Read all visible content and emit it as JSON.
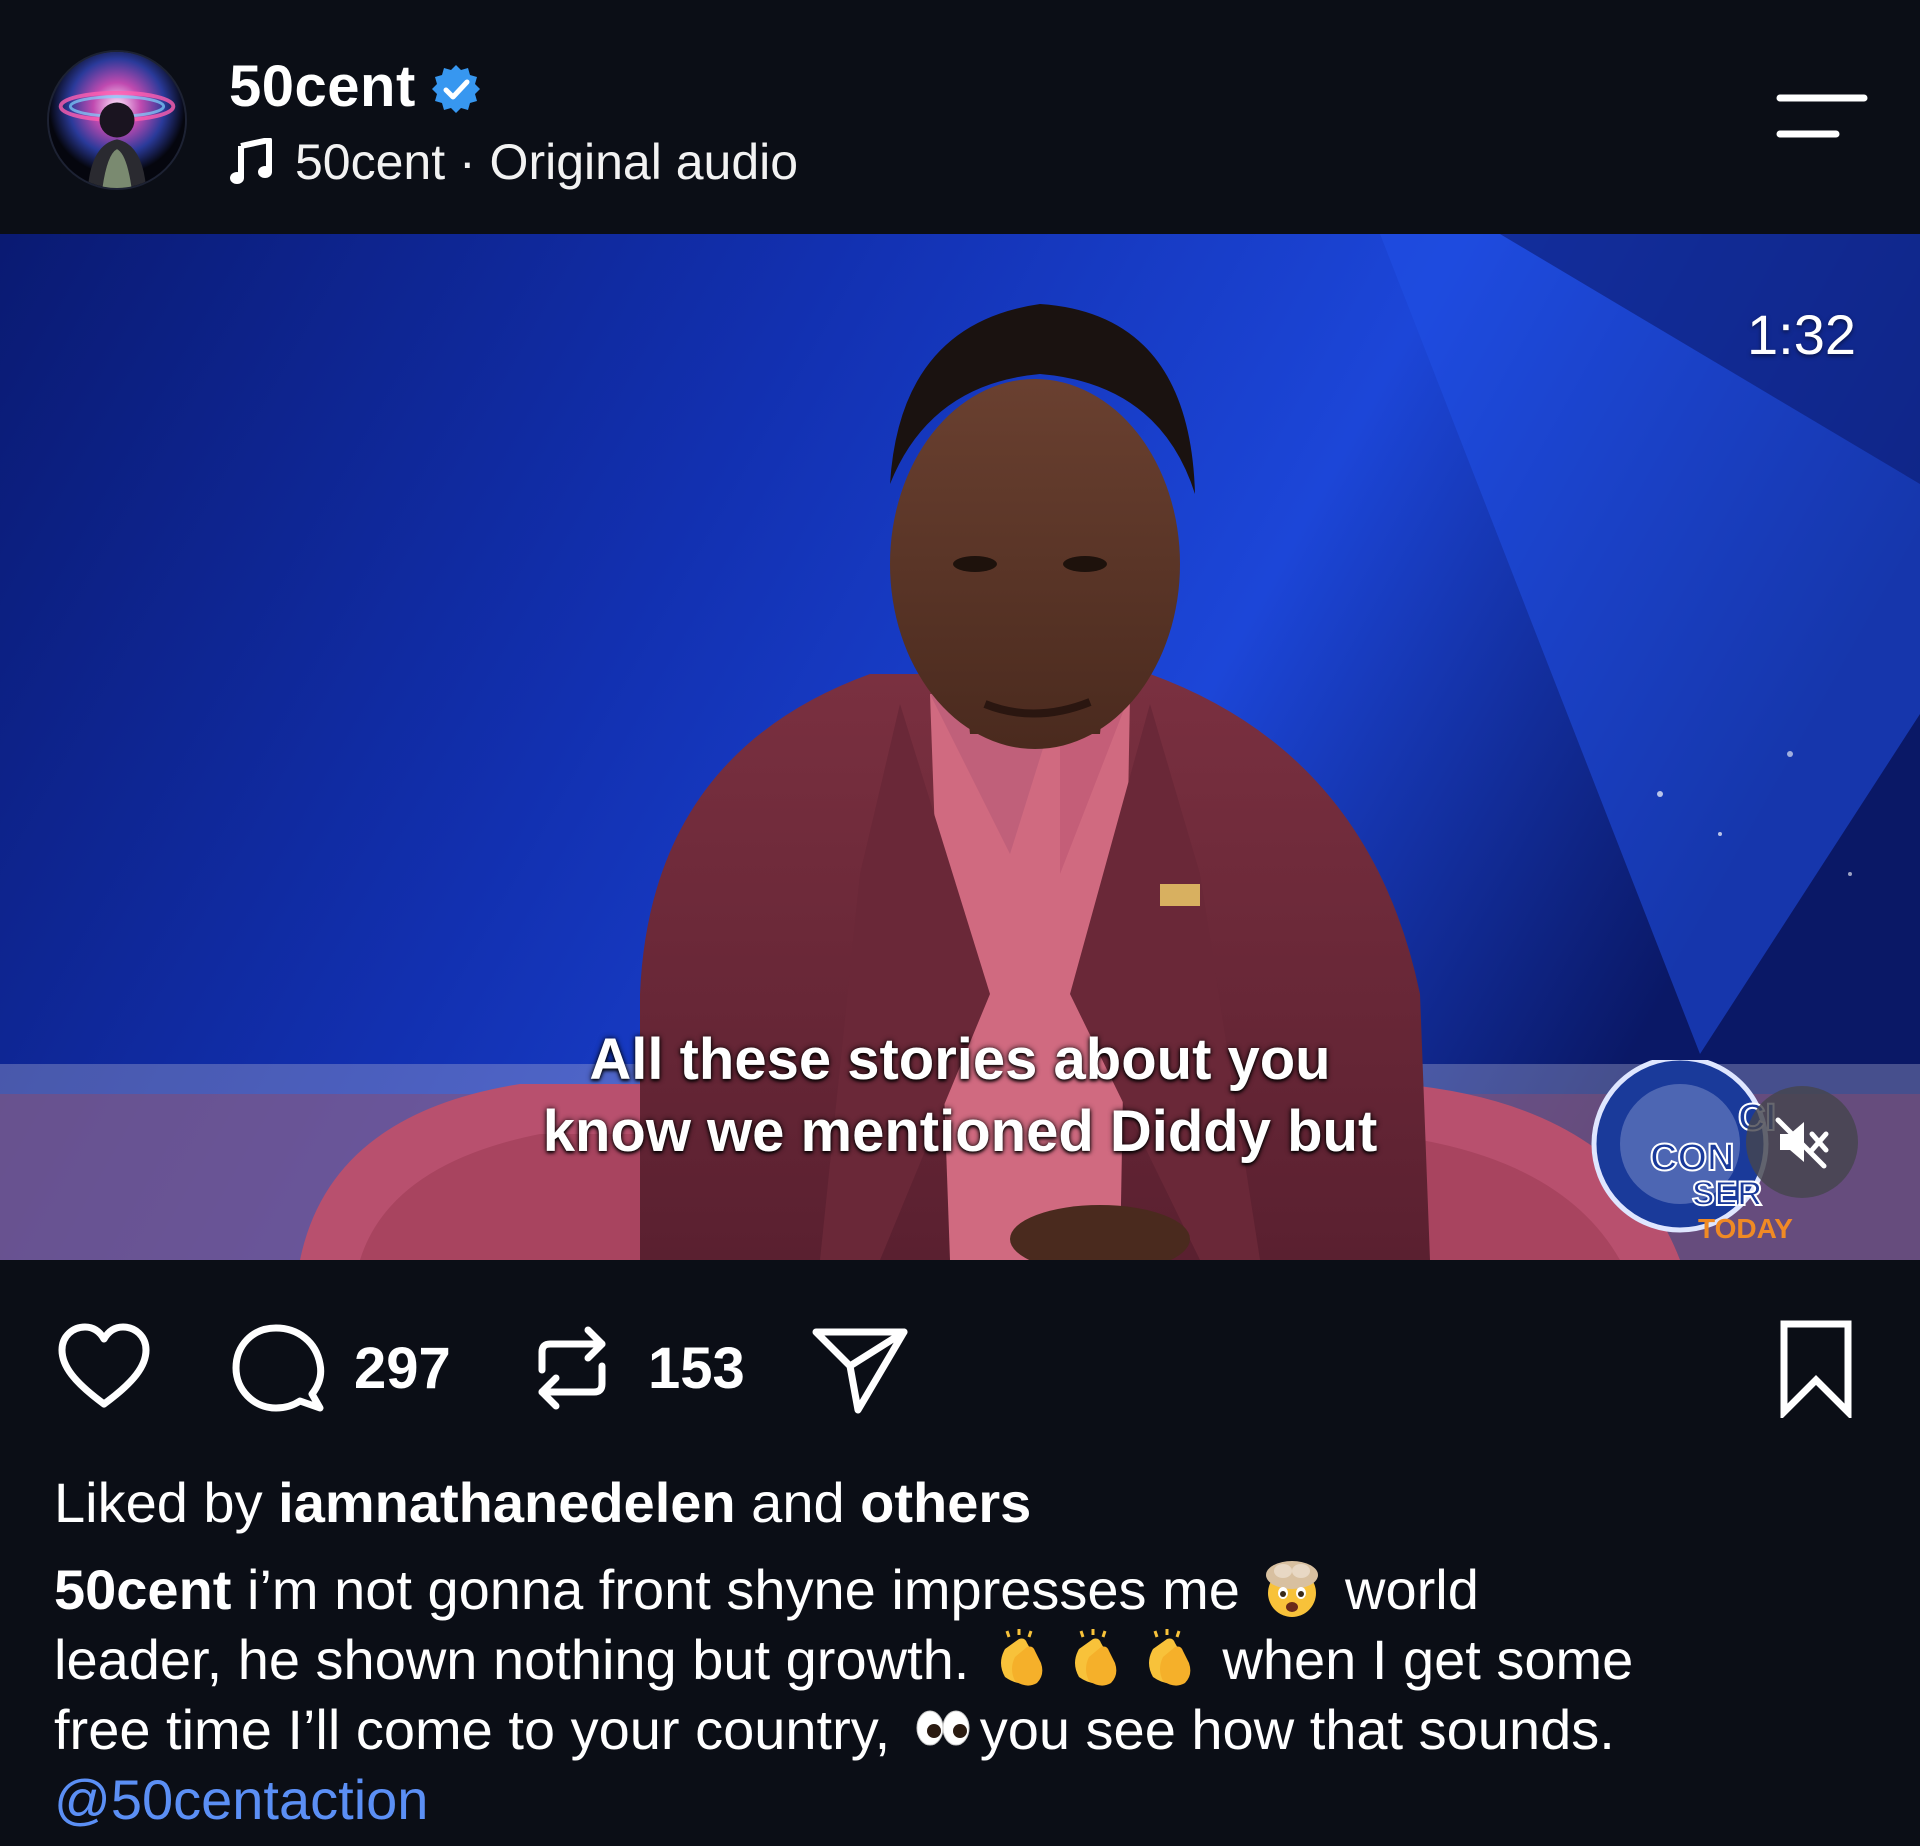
{
  "header": {
    "username": "50cent",
    "audio_label": "50cent · Original audio",
    "verified_icon": "verified-badge-icon",
    "music_icon": "music-note-icon",
    "menu_icon": "menu-icon"
  },
  "video": {
    "timestamp": "1:32",
    "caption_line1": "All these stories about you",
    "caption_line2": "know we mentioned Diddy but",
    "logo_text_1": "CI",
    "logo_text_2": "CON",
    "logo_text_3": "SER",
    "logo_text_4": "TODAY",
    "mute_icon": "speaker-muted-icon"
  },
  "actions": {
    "like_icon": "heart-icon",
    "comment_icon": "comment-bubble-icon",
    "comment_count": "297",
    "repost_icon": "repost-icon",
    "repost_count": "153",
    "share_icon": "paper-plane-icon",
    "save_icon": "bookmark-icon"
  },
  "likes": {
    "prefix": "Liked by ",
    "user": "iamnathanedelen",
    "middle": " and ",
    "others": "others"
  },
  "post_caption": {
    "author": "50cent",
    "text_part1": " i’m not gonna front shyne impresses me ",
    "text_part2": " world",
    "text_part3": "leader, he shown nothing but growth. ",
    "text_part4": " when I get some",
    "text_part5": "free time I’ll come to your country, ",
    "text_part6": "you see how that sounds.",
    "mention": "@50centaction"
  },
  "colors": {
    "background": "#0b0e16",
    "verified_blue": "#3797f0",
    "mention_blue": "#5b8ff5"
  }
}
